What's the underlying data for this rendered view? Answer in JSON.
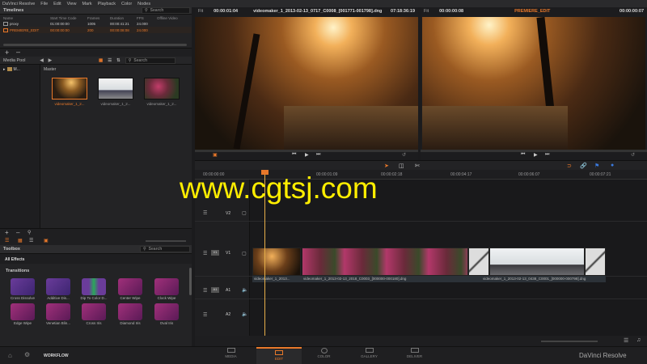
{
  "menu": {
    "app": "DaVinci Resolve",
    "items": [
      "File",
      "Edit",
      "View",
      "Mark",
      "Playback",
      "Color",
      "Nodes"
    ]
  },
  "timelines": {
    "title": "Timelines",
    "search_placeholder": "Search",
    "columns": [
      "Name",
      "Start Time Code",
      "Frames",
      "Duration",
      "FPS",
      "Offline Video"
    ],
    "rows": [
      {
        "name": "proxy",
        "start": "01:00:00:00",
        "frames": "1005",
        "duration": "00:00:41:21",
        "fps": "24.000"
      },
      {
        "name": "PREMIERE_EDIT",
        "start": "00:00:00:00",
        "frames": "200",
        "duration": "00:00:08:08",
        "fps": "24.000"
      }
    ]
  },
  "media_pool": {
    "title": "Media Pool",
    "folder": "Master",
    "tree_item": "M...",
    "search_placeholder": "Search",
    "clips": [
      "videomaker_1_2...",
      "videomaker_1_2...",
      "videomaker_1_2..."
    ]
  },
  "toolbox": {
    "title": "Toolbox",
    "search_placeholder": "Search",
    "filter": "All Effects",
    "section": "Transitions",
    "effects": [
      "Cross Dissolve",
      "Additive Dis...",
      "Dip To Color D...",
      "Center Wipe",
      "Clock Wipe",
      "Edge Wipe",
      "Venetian Blin...",
      "Cross Iris",
      "Diamond Iris",
      "Oval Iris"
    ]
  },
  "source_viewer": {
    "zoom": "Fit",
    "timecode": "00:00:01:04",
    "clip": "videomaker_1_2013-02-13_0717_C0008_[001771-001798].dng",
    "tc2": "07:18:36:19"
  },
  "record_viewer": {
    "zoom": "Fit",
    "timeline": "PREMIERE_EDIT",
    "timecode": "00:00:00:08",
    "tc2": "00:00:00:07"
  },
  "timeline": {
    "ruler": [
      "00:00:00:00",
      "00:00:01:09",
      "00:00:02:18",
      "00:00:04:17",
      "00:00:06:07",
      "00:00:07:21"
    ],
    "tracks": [
      "V2",
      "V1",
      "A1",
      "A2"
    ],
    "clip_labels": [
      "videomaker_1_2013...",
      "videomaker_1_2013-02-13_2018_C0003_[000000-000180].dng",
      "videomaker_1_2013-02-13_0438_C0001_[000000-000798].dng"
    ]
  },
  "pages": {
    "workflow": "WORKFLOW",
    "items": [
      "MEDIA",
      "EDIT",
      "COLOR",
      "GALLERY",
      "DELIVER"
    ],
    "active": "EDIT"
  },
  "brand": "DaVinci Resolve",
  "watermark": "www.cgtsj.com",
  "colors": {
    "accent": "#e8782a",
    "watermark": "#ffee00",
    "bg": "#1b1b1d"
  }
}
